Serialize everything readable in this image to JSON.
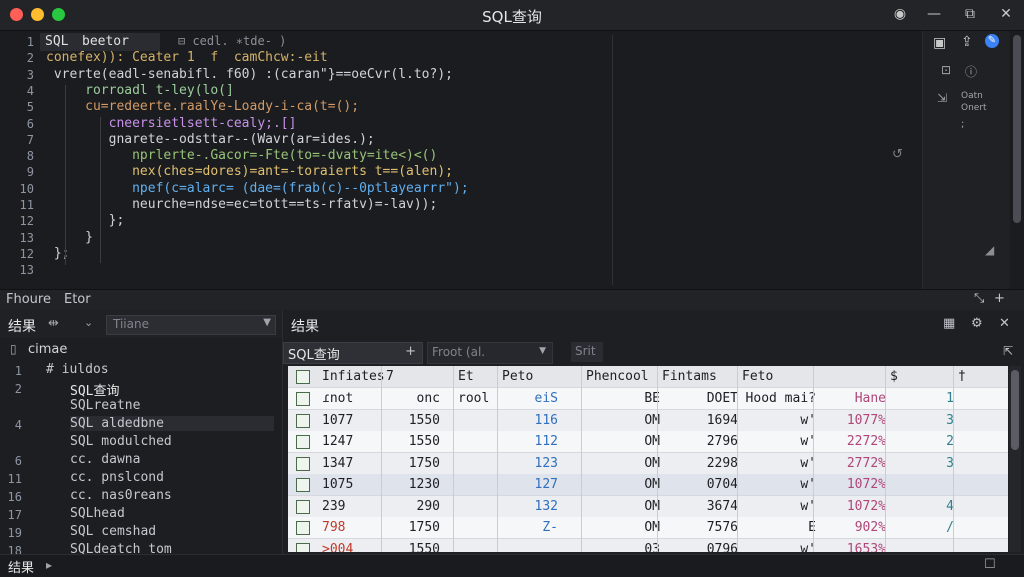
{
  "window": {
    "title": "SQL查询"
  },
  "editor": {
    "tab_label": "SQL ",
    "tab_name": "beetor",
    "tab_hint": "⊟  cedl. ∗tde- )",
    "lines": [
      {
        "n": "1",
        "text": ""
      },
      {
        "n": "2",
        "text": "conefex)): Ceater 1  f  camChcw:-eit"
      },
      {
        "n": "3",
        "text": " vrerte(eadl-senabifl. f60) :(caran\"}==oeCvr(l.to?);"
      },
      {
        "n": "4",
        "text": "     rorroadl t-ley(lo(]"
      },
      {
        "n": "5",
        "text": "     cu=redeerte.raalYe-Loady-i-ca(t=();"
      },
      {
        "n": "6",
        "text": "        cneersietlsett-cealy;.[]"
      },
      {
        "n": "7",
        "text": "        gnarete--odsttar--(Wavr(ar=ides.);"
      },
      {
        "n": "8",
        "text": "           nprlerte-.Gacor=-Fte(to=-dvaty=ite<)<()"
      },
      {
        "n": "9",
        "text": "           nex(ches=dores)=ant=-toraierts t==(alen);"
      },
      {
        "n": "10",
        "text": "           npef(c=alarc= (dae=(frab(c)--0ptlayearrr\");"
      },
      {
        "n": "11",
        "text": "           neurche=ndse=ec=tott==ts-rfatv)=-lav));"
      },
      {
        "n": "12",
        "text": "        };"
      },
      {
        "n": "13",
        "text": "     }"
      },
      {
        "n": "12",
        "text": " };"
      },
      {
        "n": "13",
        "text": ""
      }
    ]
  },
  "mid_sidebar": {
    "line1": "Oatn",
    "line2": "Onert"
  },
  "tabs": {
    "tab1": "Fhoure",
    "tab2": "Etor"
  },
  "left_panel": {
    "title": "结果",
    "select_placeholder": "Tiiane",
    "root": "cimae",
    "rows": [
      {
        "n": "1",
        "text": "#  iuldos"
      },
      {
        "n": "2",
        "text": "SQL查询"
      },
      {
        "n": "",
        "text": "SQLreatne"
      },
      {
        "n": "4",
        "text": "SQL aldedbne"
      },
      {
        "n": "",
        "text": "SQL modulched"
      },
      {
        "n": "6",
        "text": "cc.  dawna"
      },
      {
        "n": "11",
        "text": "cc. pnslcond"
      },
      {
        "n": "16",
        "text": "cc. nas0reans"
      },
      {
        "n": "17",
        "text": "SQLhead"
      },
      {
        "n": "19",
        "text": "SQL cemshad"
      },
      {
        "n": "18",
        "text": "SQLdeatch_tom"
      }
    ]
  },
  "right_panel": {
    "title": "结果",
    "query_label": "SQL查询",
    "filter_label": "Froot (al.",
    "sort_label": "Srit",
    "columns": [
      "Infiates",
      "7",
      "Et",
      "Peto",
      "Phencool",
      "Fintams",
      "Feto",
      "",
      "$",
      "†"
    ],
    "rows": [
      [
        "ɾnot",
        "onc",
        "rool",
        "eiS",
        "BE",
        "DOET",
        "Hood mai?",
        "Hane",
        "1",
        ""
      ],
      [
        "1077",
        "1550",
        "",
        "116",
        "OM",
        "1694",
        "w'",
        "1077%",
        "3",
        ""
      ],
      [
        "1247",
        "1550",
        "",
        "112",
        "OM",
        "2796",
        "w'",
        "2272%",
        "2",
        ""
      ],
      [
        "1347",
        "1750",
        "",
        "123",
        "OM",
        "2298",
        "w'",
        "2772%",
        "3",
        ""
      ],
      [
        "1075",
        "1230",
        "",
        "127",
        "OM",
        "0704",
        "w'",
        "1072%",
        "",
        ""
      ],
      [
        "239",
        "290",
        "",
        "132",
        "OM",
        "3674",
        "w'",
        "1072%",
        "4",
        ""
      ],
      [
        "798",
        "1750",
        "",
        "Z-",
        "OM",
        "7576",
        "E",
        "902%",
        "/",
        ""
      ],
      [
        ">004",
        "1550",
        "",
        "",
        "03",
        "0796",
        "w'",
        "1653%",
        "",
        ""
      ]
    ]
  },
  "status": {
    "label": "结果"
  },
  "colors": {
    "accent": "#3b82f6",
    "close": "#ff5f57",
    "minimize": "#febc2e",
    "maximize": "#28c840"
  }
}
